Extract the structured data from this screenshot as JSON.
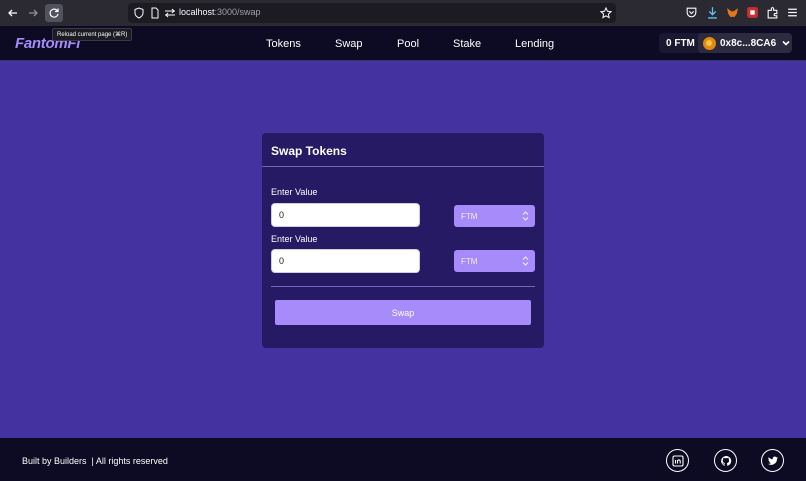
{
  "browser": {
    "tooltip": "Reload current page (⌘R)",
    "url_host": "localhost",
    "url_path": ":3000/swap"
  },
  "header": {
    "logo": "FantomFi",
    "nav": [
      "Tokens",
      "Swap",
      "Pool",
      "Stake",
      "Lending"
    ],
    "balance": "0 FTM",
    "account": "0x8c...8CA6"
  },
  "swap": {
    "title": "Swap Tokens",
    "field1_label": "Enter Value",
    "field1_value": "0",
    "field1_token": "FTM",
    "field2_label": "Enter Value",
    "field2_value": "0",
    "field2_token": "FTM",
    "button": "Swap"
  },
  "footer": {
    "text": "Built by Builders  | All rights reserved",
    "social": [
      "linkedin-icon",
      "github-icon",
      "twitter-icon"
    ]
  },
  "colors": {
    "page_bg": "#4332a0",
    "card_bg": "#251a63",
    "accent": "#a78bfa",
    "header_bg": "#0d0b24"
  }
}
